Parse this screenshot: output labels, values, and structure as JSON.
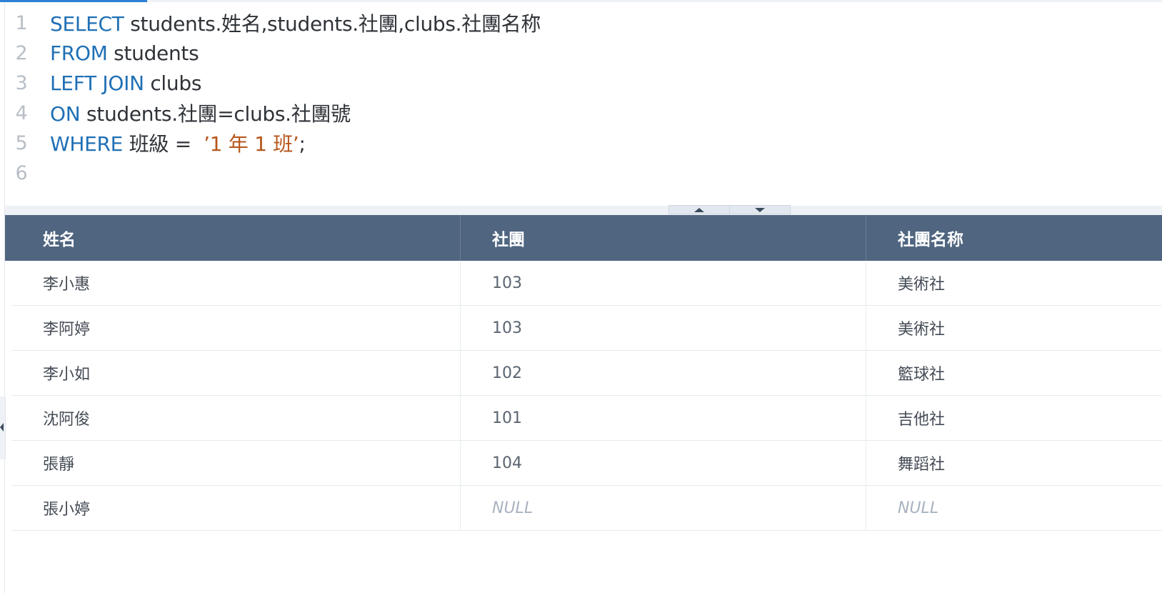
{
  "editor": {
    "lines": [
      {
        "no": "1",
        "parts": [
          {
            "t": "SELECT",
            "k": "kw"
          },
          {
            "t": " students.姓名,students.社團,clubs.社團名称",
            "k": "plain"
          }
        ]
      },
      {
        "no": "2",
        "parts": [
          {
            "t": "FROM",
            "k": "kw"
          },
          {
            "t": " students",
            "k": "plain"
          }
        ]
      },
      {
        "no": "3",
        "parts": [
          {
            "t": "LEFT JOIN",
            "k": "kw"
          },
          {
            "t": " clubs",
            "k": "plain"
          }
        ]
      },
      {
        "no": "4",
        "parts": [
          {
            "t": "ON",
            "k": "kw"
          },
          {
            "t": " students.社團=clubs.社團號",
            "k": "plain"
          }
        ]
      },
      {
        "no": "5",
        "parts": [
          {
            "t": "WHERE",
            "k": "kw"
          },
          {
            "t": " 班級 =  ",
            "k": "plain"
          },
          {
            "t": "’1 年 1 班’",
            "k": "str"
          },
          {
            "t": ";",
            "k": "plain"
          }
        ]
      },
      {
        "no": "6",
        "parts": []
      }
    ]
  },
  "results": {
    "columns": [
      "姓名",
      "社團",
      "社團名称"
    ],
    "rows": [
      [
        "李小惠",
        "103",
        "美術社"
      ],
      [
        "李阿婷",
        "103",
        "美術社"
      ],
      [
        "李小如",
        "102",
        "籃球社"
      ],
      [
        "沈阿俊",
        "101",
        "吉他社"
      ],
      [
        "張靜",
        "104",
        "舞蹈社"
      ],
      [
        "張小婷",
        "NULL",
        "NULL"
      ]
    ]
  },
  "icons": {
    "splitter_up": "chevron-up-icon",
    "splitter_down": "chevron-down-icon",
    "side_handle": "chevron-left-icon"
  },
  "colors": {
    "keyword": "#1f6fb5",
    "string": "#b6561a",
    "header_bg": "#4f6580",
    "accent": "#2b7fd4"
  }
}
